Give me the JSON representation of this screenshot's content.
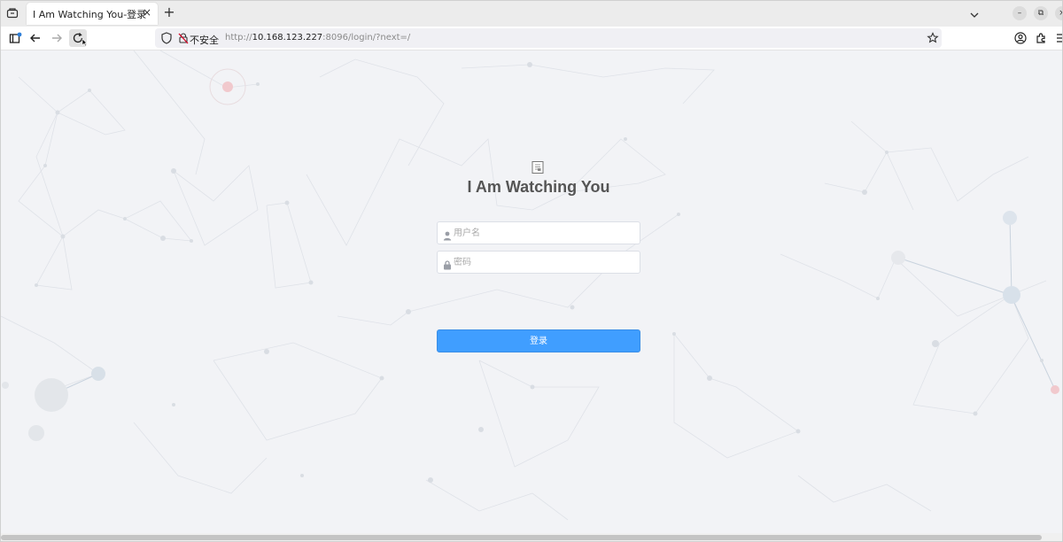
{
  "browser": {
    "tab_title": "I Am Watching You-登录",
    "tab_close": "×",
    "new_tab": "+",
    "security_label": "不安全",
    "url_prefix": "http://",
    "url_host": "10.168.123.227",
    "url_rest": ":8096/login/?next=/",
    "window_controls": {
      "minimize": "–",
      "restore": "⧉",
      "close": "×"
    }
  },
  "login": {
    "title": "I Am Watching You",
    "username_placeholder": "用户名",
    "password_placeholder": "密码",
    "submit_label": "登录"
  },
  "colors": {
    "primary": "#409eff",
    "page_bg": "#f2f3f6"
  }
}
